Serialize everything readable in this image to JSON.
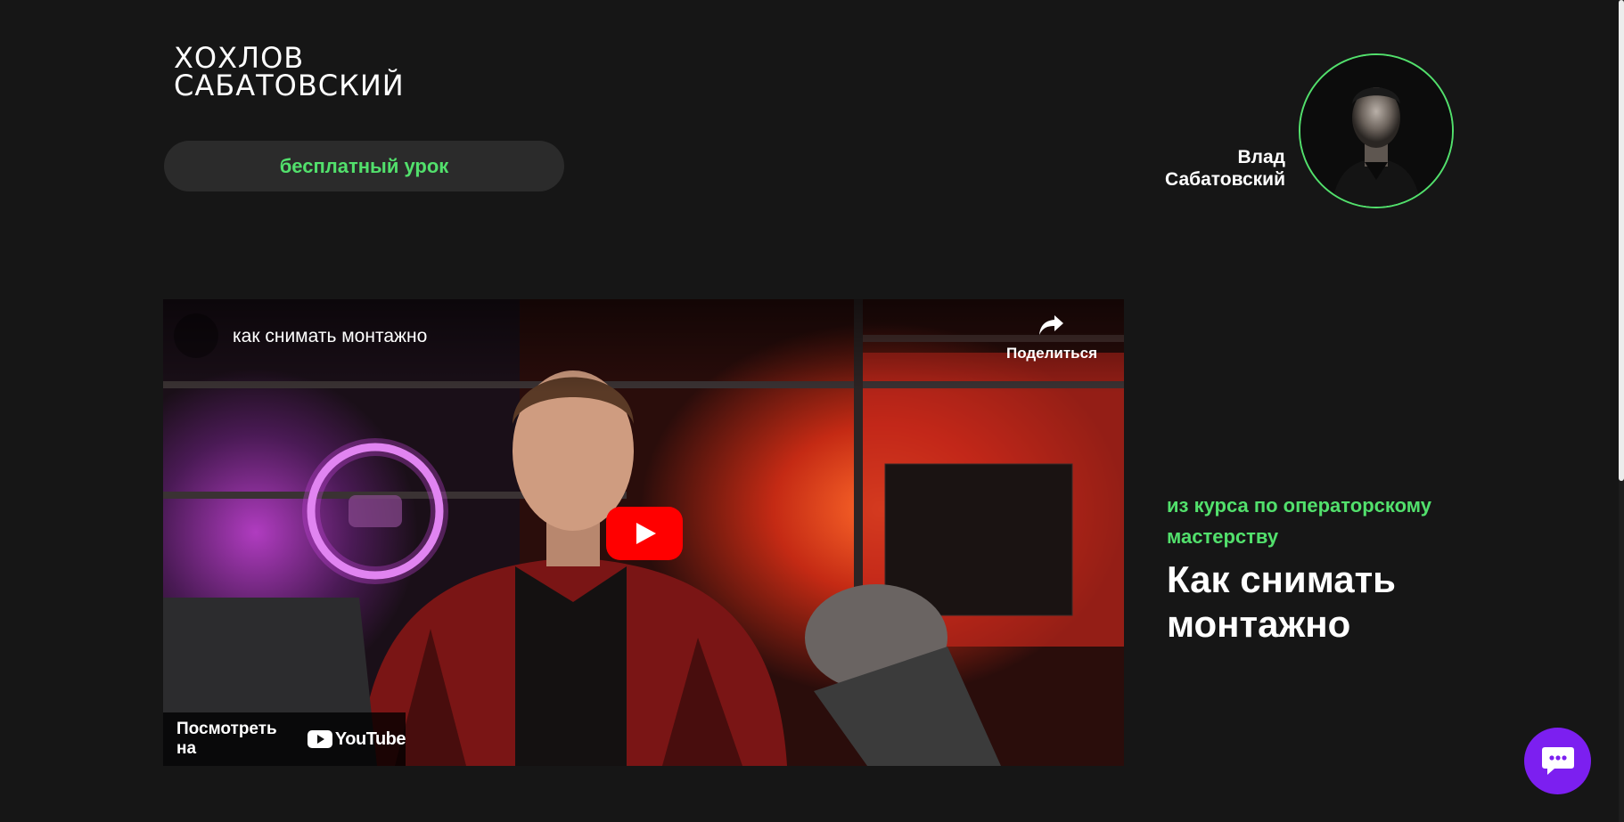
{
  "logo": {
    "line1": "ХОХЛОВ",
    "line2": "САБАТОВСКИЙ"
  },
  "header": {
    "lesson_badge": "бесплатный урок"
  },
  "author": {
    "first_name": "Влад",
    "last_name": "Сабатовский"
  },
  "video": {
    "title": "как снимать монтажно",
    "share_label": "Поделиться",
    "watch_on_label": "Посмотреть на",
    "platform_name": "YouTube",
    "play_icon": "youtube-play-icon",
    "share_icon": "share-arrow-icon"
  },
  "course": {
    "subtitle": "из курса по операторскому мастерству",
    "title": "Как снимать монтажно"
  },
  "chat": {
    "icon": "chat-bubble-icon"
  },
  "colors": {
    "background": "#161616",
    "accent_green": "#52e06c",
    "chat_purple": "#7c1ff0",
    "youtube_red": "#ff0000"
  }
}
